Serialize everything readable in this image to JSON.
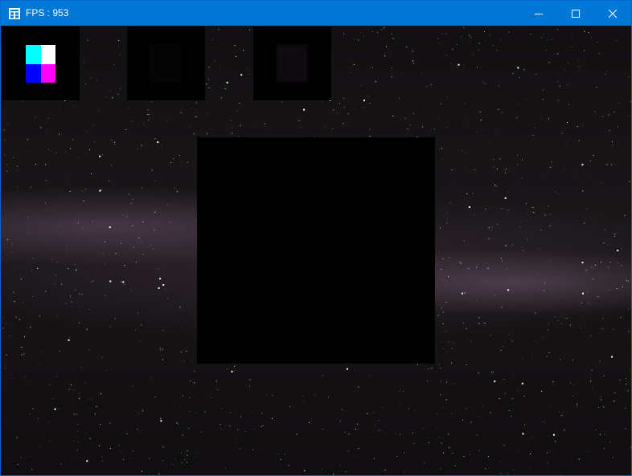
{
  "window": {
    "title": "FPS : 953",
    "icon": "app-window-icon",
    "controls": {
      "minimize": "minimize-icon",
      "maximize": "maximize-icon",
      "close": "close-icon"
    },
    "titlebar_color": "#0078d7"
  },
  "scene": {
    "background": "starfield-milky-way",
    "texture_colors": {
      "top_left": "#00ffff",
      "top_right": "#ffffff",
      "bottom_left": "#0000ff",
      "bottom_right": "#ff00ff"
    },
    "main_quad_color": "#000000"
  }
}
